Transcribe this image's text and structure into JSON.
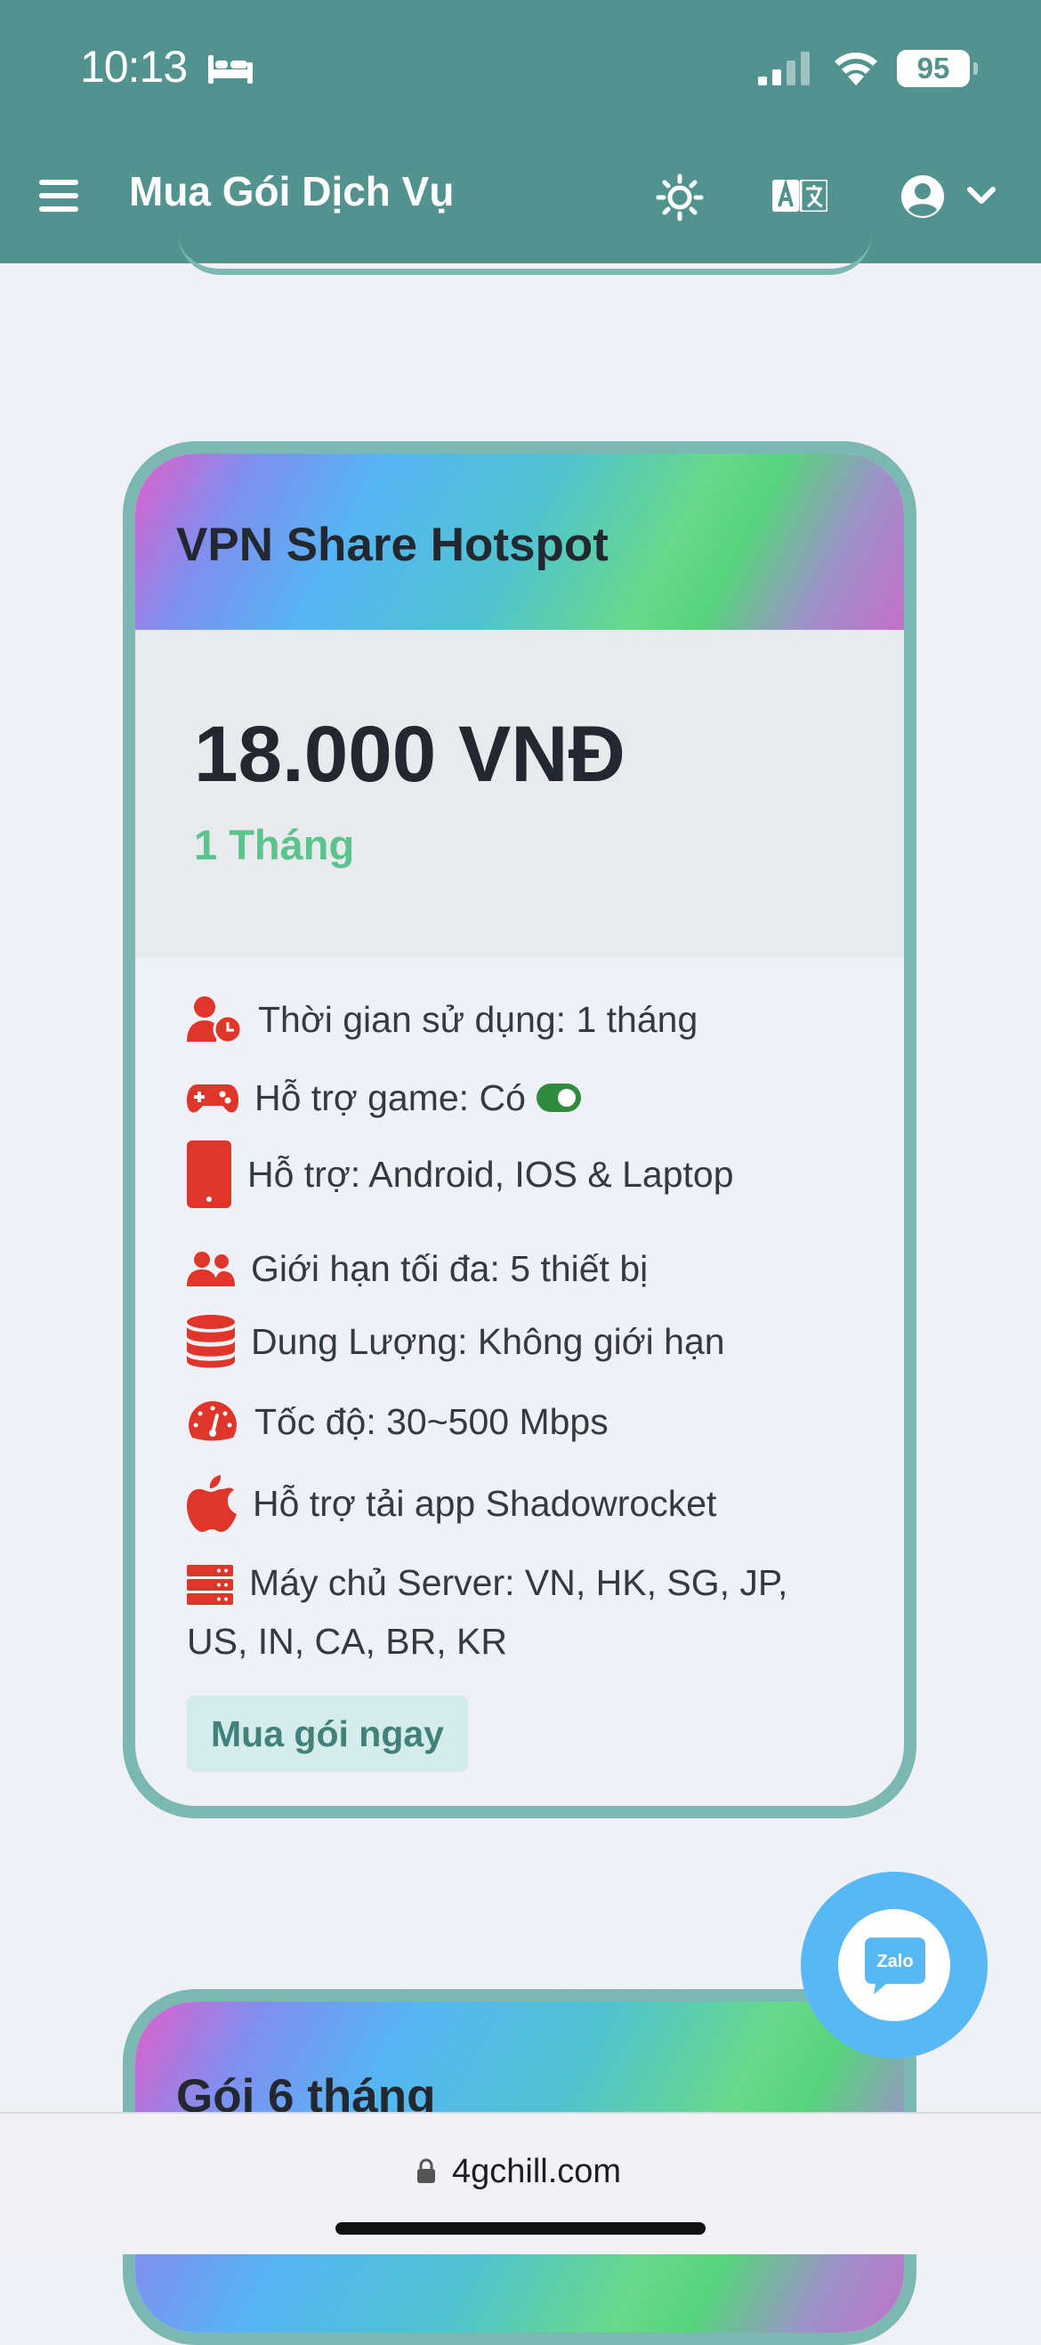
{
  "status_bar": {
    "time": "10:13",
    "battery": "95"
  },
  "app_bar": {
    "title": "Mua Gói Dịch Vụ"
  },
  "card": {
    "title": "VPN Share Hotspot",
    "price": "18.000 VNĐ",
    "duration": "1 Tháng",
    "features": [
      {
        "icon": "user-clock-icon",
        "text": "Thời gian sử dụng: 1 tháng"
      },
      {
        "icon": "gamepad-icon",
        "text": "Hỗ trợ game: Có"
      },
      {
        "icon": "mobile-icon",
        "text": "Hỗ trợ: Android, IOS & Laptop"
      },
      {
        "icon": "users-icon",
        "text": "Giới hạn tối đa: 5 thiết bị"
      },
      {
        "icon": "database-icon",
        "text": "Dung Lượng: Không giới hạn"
      },
      {
        "icon": "speedometer-icon",
        "text": "Tốc độ: 30~500 Mbps"
      },
      {
        "icon": "apple-icon",
        "text": "Hỗ trợ tải app Shadowrocket"
      },
      {
        "icon": "server-icon",
        "text": "Máy chủ Server: VN, HK, SG, JP, US, IN, CA, BR, KR"
      }
    ],
    "game_support_toggle_on": true,
    "buy_label": "Mua gói ngay"
  },
  "next_card": {
    "title": "Gói 6 tháng"
  },
  "zalo": {
    "label": "Zalo"
  },
  "browser": {
    "url": "4gchill.com"
  },
  "colors": {
    "header": "#52938f",
    "card_border": "#7bb8b1",
    "icon_red": "#e0352b",
    "duration_green": "#5cc38c",
    "zalo_blue": "#58b8f4"
  }
}
